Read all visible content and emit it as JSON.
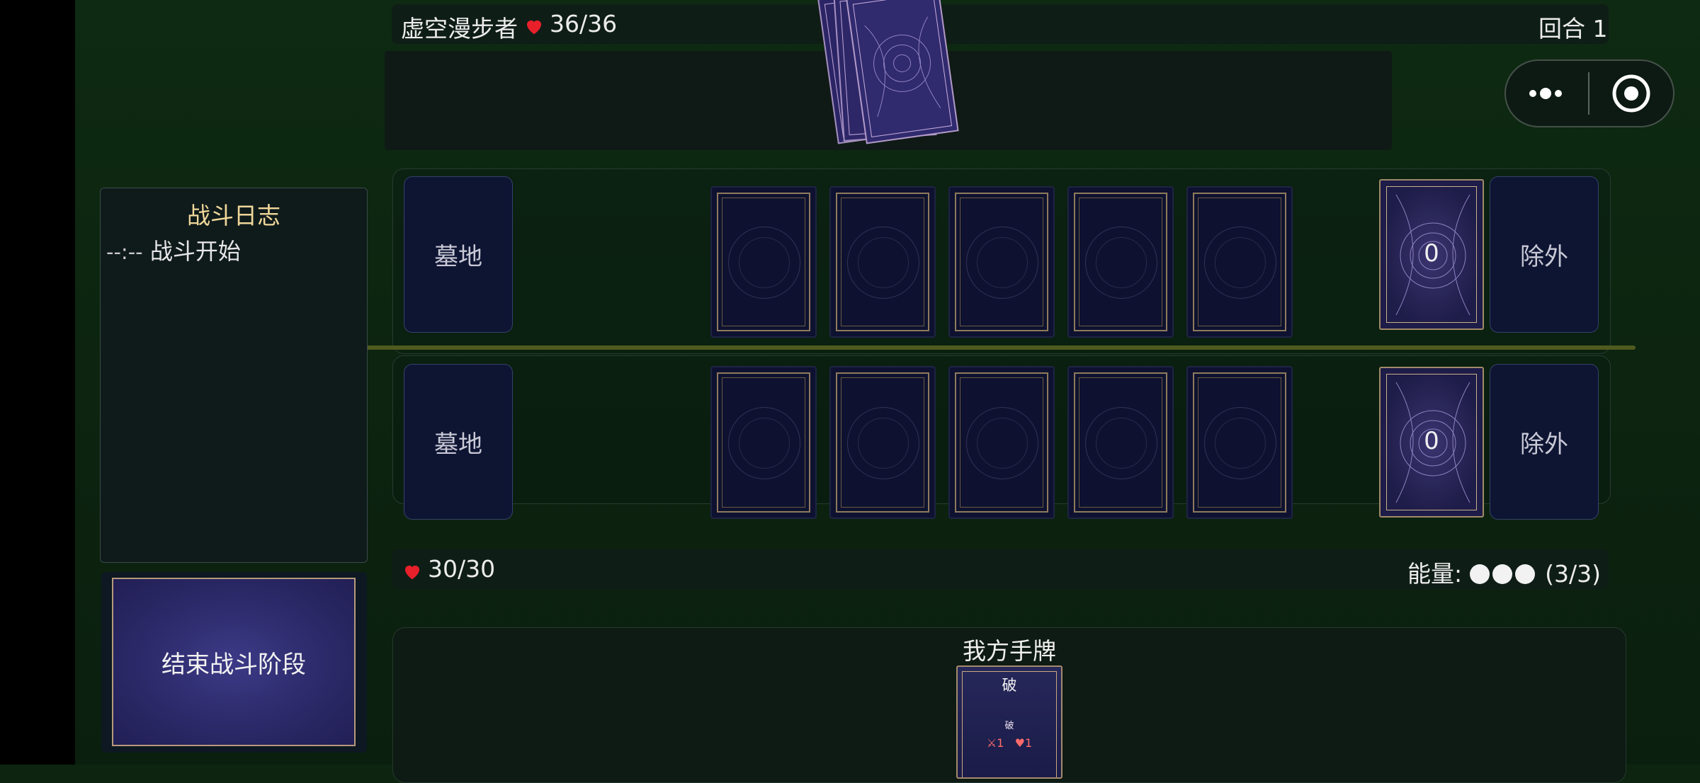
{
  "enemy": {
    "name": "虚空漫步者",
    "hp_text": "36/36",
    "turn_label": "回合 1"
  },
  "enemy_field": {
    "graveyard_label": "墓地",
    "exile_label": "除外",
    "deck_count": "0"
  },
  "player_field": {
    "graveyard_label": "墓地",
    "exile_label": "除外",
    "deck_count": "0"
  },
  "player": {
    "hp_text": "30/30",
    "energy_label": "能量:",
    "energy_current": 3,
    "energy_max": 3,
    "energy_text": "(3/3)"
  },
  "battle_log": {
    "title": "战斗日志",
    "entries": [
      {
        "time": "--:--",
        "text": "战斗开始"
      }
    ]
  },
  "end_phase_button": {
    "label": "结束战斗阶段"
  },
  "hand": {
    "title": "我方手牌",
    "cards": [
      {
        "name": "破",
        "subtitle": "破",
        "attack": "1",
        "health": "1"
      }
    ]
  },
  "colors": {
    "heart": "#e8202a",
    "log_title": "#efd79a",
    "card_border": "#a48a6a"
  },
  "icons": [
    "heart-icon",
    "sword-icon",
    "more-icon",
    "target-icon"
  ]
}
